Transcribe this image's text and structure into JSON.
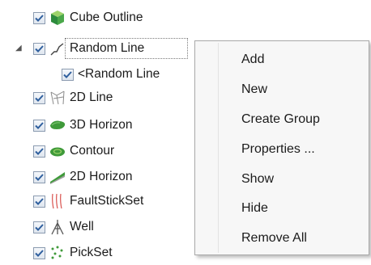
{
  "tree": {
    "items": [
      {
        "label": "Cube Outline",
        "checked": true,
        "icon": "cube-icon"
      },
      {
        "label": "Random Line",
        "checked": true,
        "icon": "random-line-icon",
        "expanded": true
      },
      {
        "label": "<Random Line",
        "checked": true,
        "icon": "none"
      },
      {
        "label": "2D Line",
        "checked": true,
        "icon": "2d-line-icon"
      },
      {
        "label": "3D Horizon",
        "checked": true,
        "icon": "3d-horizon-icon"
      },
      {
        "label": "Contour",
        "checked": true,
        "icon": "contour-icon"
      },
      {
        "label": "2D Horizon",
        "checked": true,
        "icon": "2d-horizon-icon"
      },
      {
        "label": "FaultStickSet",
        "checked": true,
        "icon": "fault-stick-set-icon"
      },
      {
        "label": "Well",
        "checked": true,
        "icon": "well-icon"
      },
      {
        "label": "PickSet",
        "checked": true,
        "icon": "pickset-icon"
      }
    ]
  },
  "context_menu": {
    "items": [
      {
        "label": "Add"
      },
      {
        "label": "New"
      },
      {
        "label": "Create Group"
      },
      {
        "label": "Properties ..."
      },
      {
        "label": "Show"
      },
      {
        "label": "Hide"
      },
      {
        "label": "Remove All"
      }
    ]
  },
  "colors": {
    "check": "#2f5f9e",
    "horizon_green": "#3f9a3a",
    "fault_red": "#d9534f"
  }
}
